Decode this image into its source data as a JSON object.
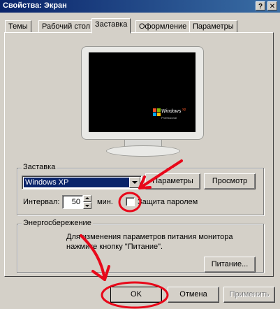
{
  "window": {
    "title": "Свойства: Экран",
    "help_label": "?",
    "close_label": "✕"
  },
  "tabs": [
    {
      "label": "Темы"
    },
    {
      "label": "Рабочий стол"
    },
    {
      "label": "Заставка"
    },
    {
      "label": "Оформление"
    },
    {
      "label": "Параметры"
    }
  ],
  "preview": {
    "logo_text": "Windows",
    "logo_sup": "xp",
    "edition_text": "Professional"
  },
  "screensaver": {
    "group_label": "Заставка",
    "selected": "Windows XP",
    "settings_button": "Параметры",
    "preview_button": "Просмотр",
    "interval_label": "Интервал:",
    "interval_value": "50",
    "interval_unit": "мин.",
    "password_label": "Защита паролем",
    "password_checked": false
  },
  "power": {
    "group_label": "Энергосбережение",
    "description": "Для изменения параметров питания монитора нажмите кнопку \"Питание\".",
    "button": "Питание..."
  },
  "footer": {
    "ok": "OK",
    "cancel": "Отмена",
    "apply": "Применить"
  },
  "colors": {
    "title_bar": "#0a246a",
    "window_face": "#d4d0c8",
    "selection": "#0a246a",
    "annotation": "#e8081a"
  }
}
